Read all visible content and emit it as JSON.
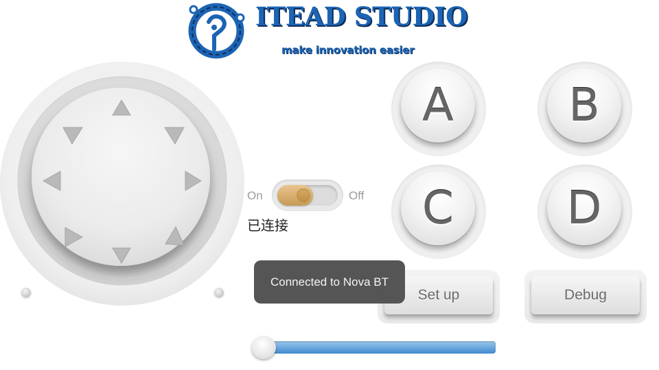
{
  "logo": {
    "mark_letter": "i",
    "title": "ITEAD STUDIO",
    "tagline": "make innovation easier",
    "color": "#1c64b4"
  },
  "dpad": {
    "directions": [
      "up",
      "up-right",
      "right",
      "down-right",
      "down",
      "down-left",
      "left",
      "up-left"
    ]
  },
  "connection_toggle": {
    "on_label": "On",
    "off_label": "Off",
    "state": "On",
    "knob_color": "#d8ac64"
  },
  "status_text": "已连接",
  "buttons": {
    "a": "A",
    "b": "B",
    "c": "C",
    "d": "D",
    "setup": "Set up",
    "debug": "Debug"
  },
  "toast": {
    "message": "Connected to Nova BT"
  },
  "slider": {
    "value": 0,
    "track_color": "#3f8ad0"
  }
}
